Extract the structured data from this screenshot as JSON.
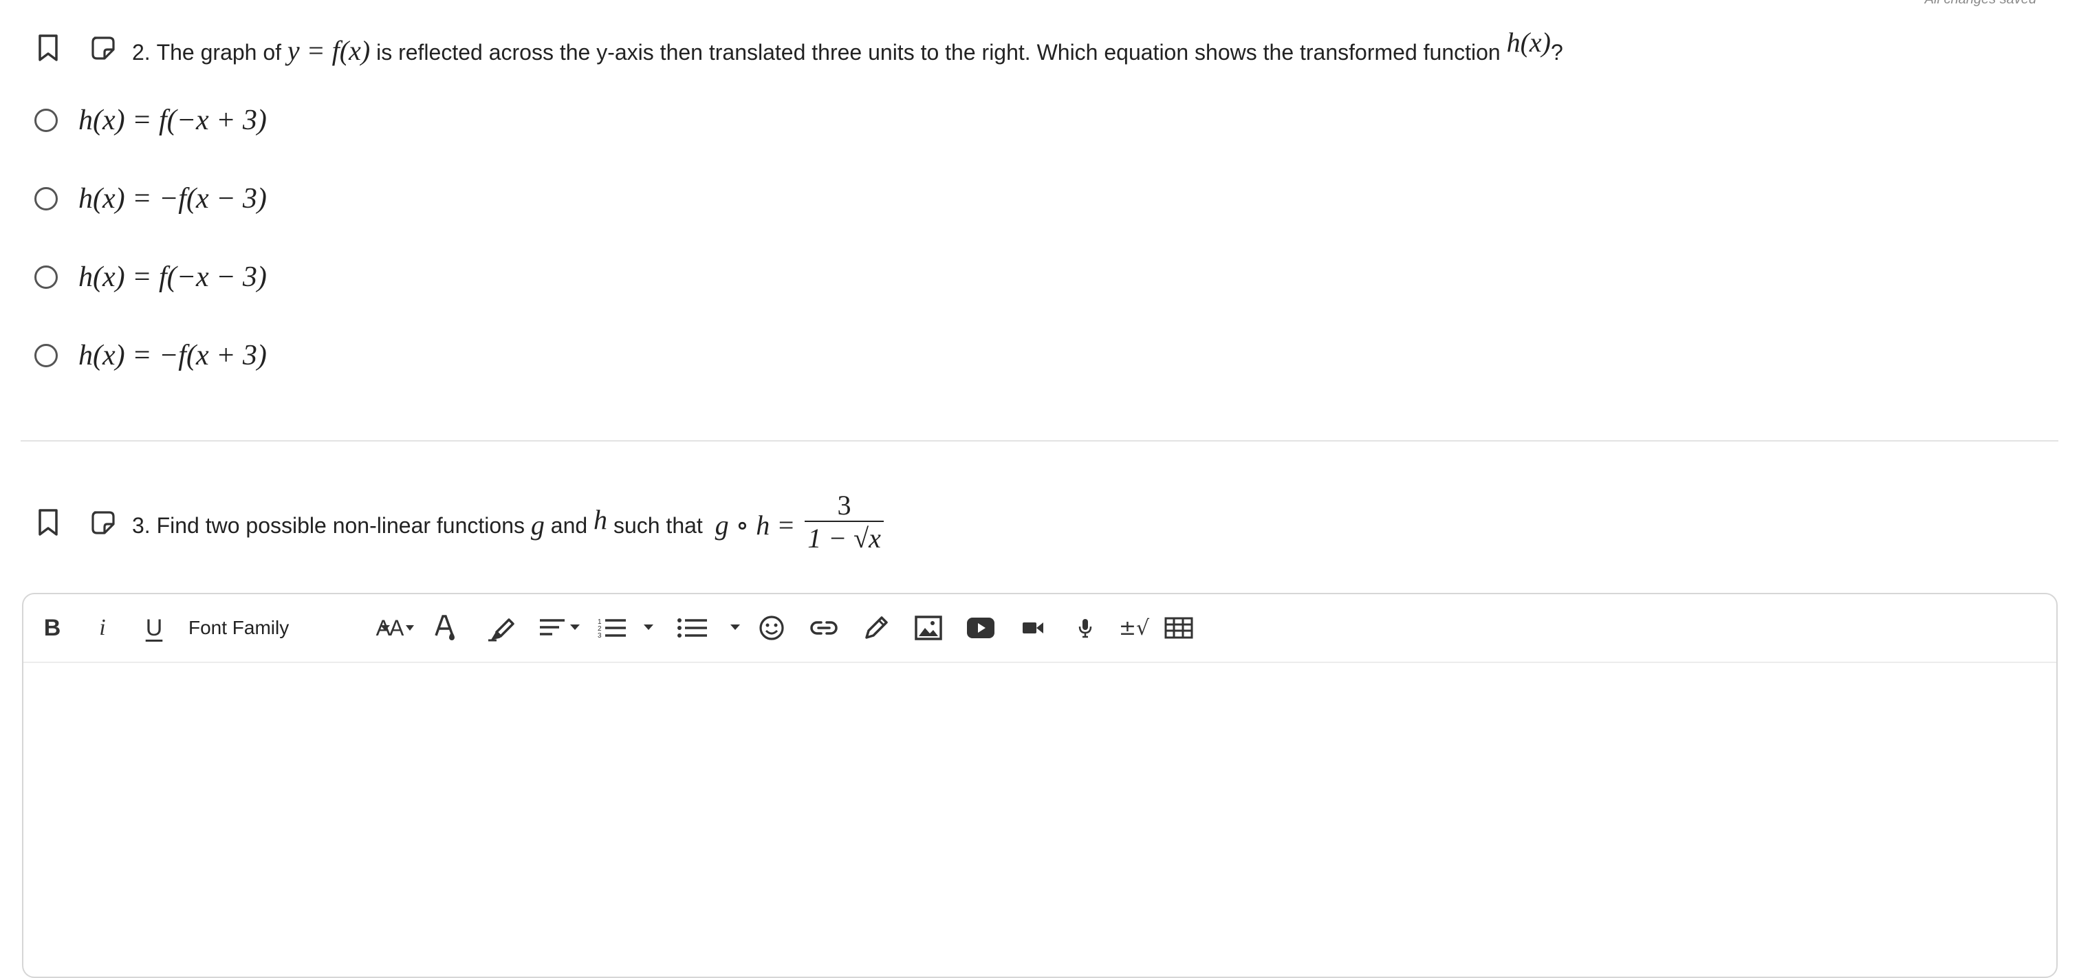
{
  "status": {
    "saved_text": "All changes saved"
  },
  "question2": {
    "number": "2.",
    "text_before": "The graph of",
    "expr_main": "y = f(x)",
    "text_after": "is reflected across the y-axis then translated three units to the right.  Which equation shows the transformed function",
    "expr_target": "h(x)",
    "text_end": "?",
    "options": [
      {
        "label": "h(x) = f(−x + 3)"
      },
      {
        "label": "h(x) = −f(x − 3)"
      },
      {
        "label": "h(x) = f(−x − 3)"
      },
      {
        "label": "h(x) = −f(x + 3)"
      }
    ]
  },
  "question3": {
    "number": "3.",
    "text_before": "Find two possible non-linear functions",
    "var_g": "g",
    "text_and": "and",
    "var_h": "h",
    "text_such": "such that",
    "expr_lhs": "g ∘ h =",
    "frac_num": "3",
    "frac_den": "1 − √x"
  },
  "editor": {
    "toolbar": {
      "bold": "B",
      "italic": "i",
      "underline": "U",
      "font_family": "Font Family",
      "font_size": "AA",
      "equation": "±√"
    },
    "icons": [
      "bookmark-icon",
      "note-icon",
      "bold-icon",
      "italic-icon",
      "underline-icon",
      "font-family-dropdown",
      "font-size-icon",
      "text-color-icon",
      "highlight-icon",
      "align-icon",
      "numbered-list-icon",
      "bulleted-list-icon",
      "emoji-icon",
      "link-icon",
      "draw-icon",
      "image-icon",
      "video-icon",
      "camera-icon",
      "microphone-icon",
      "equation-icon",
      "table-icon"
    ]
  }
}
